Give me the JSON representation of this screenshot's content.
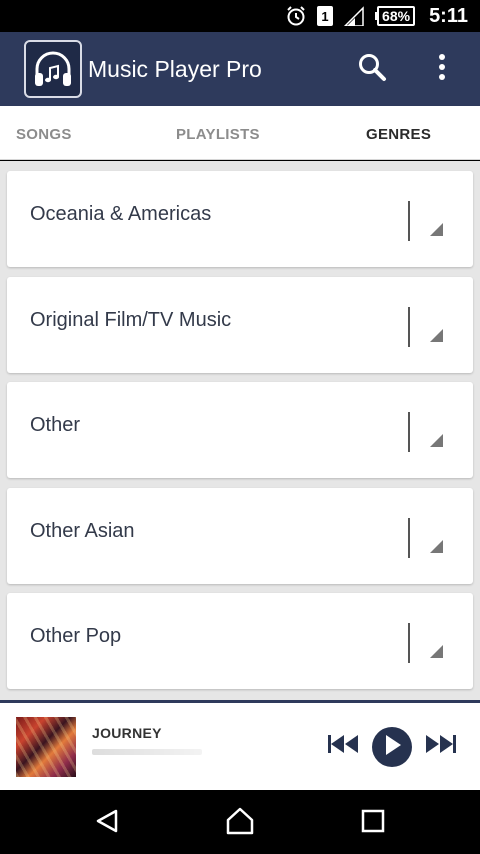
{
  "status_bar": {
    "sim_slot": "1",
    "battery_percent": "68%",
    "time": "5:11",
    "icons": [
      "alarm-icon",
      "sim-icon",
      "signal-icon",
      "battery-icon"
    ]
  },
  "app_bar": {
    "title": "Music Player Pro",
    "background_color": "#2e3a5c",
    "icons": [
      "headphones-logo-icon",
      "search-icon",
      "more-vert-icon"
    ]
  },
  "tabs": [
    {
      "label": "SONGS",
      "active": false
    },
    {
      "label": "PLAYLISTS",
      "active": false
    },
    {
      "label": "GENRES",
      "active": true
    }
  ],
  "genres": [
    {
      "name": "Oceania & Americas"
    },
    {
      "name": "Original Film/TV Music"
    },
    {
      "name": "Other"
    },
    {
      "name": "Other Asian"
    },
    {
      "name": "Other Pop"
    }
  ],
  "now_playing": {
    "title": "JOURNEY",
    "controls": [
      "skip-previous-icon",
      "play-icon",
      "skip-next-icon"
    ],
    "accent_color": "#26324f"
  },
  "nav_bar": {
    "icons": [
      "back-icon",
      "home-icon",
      "recents-icon"
    ]
  }
}
